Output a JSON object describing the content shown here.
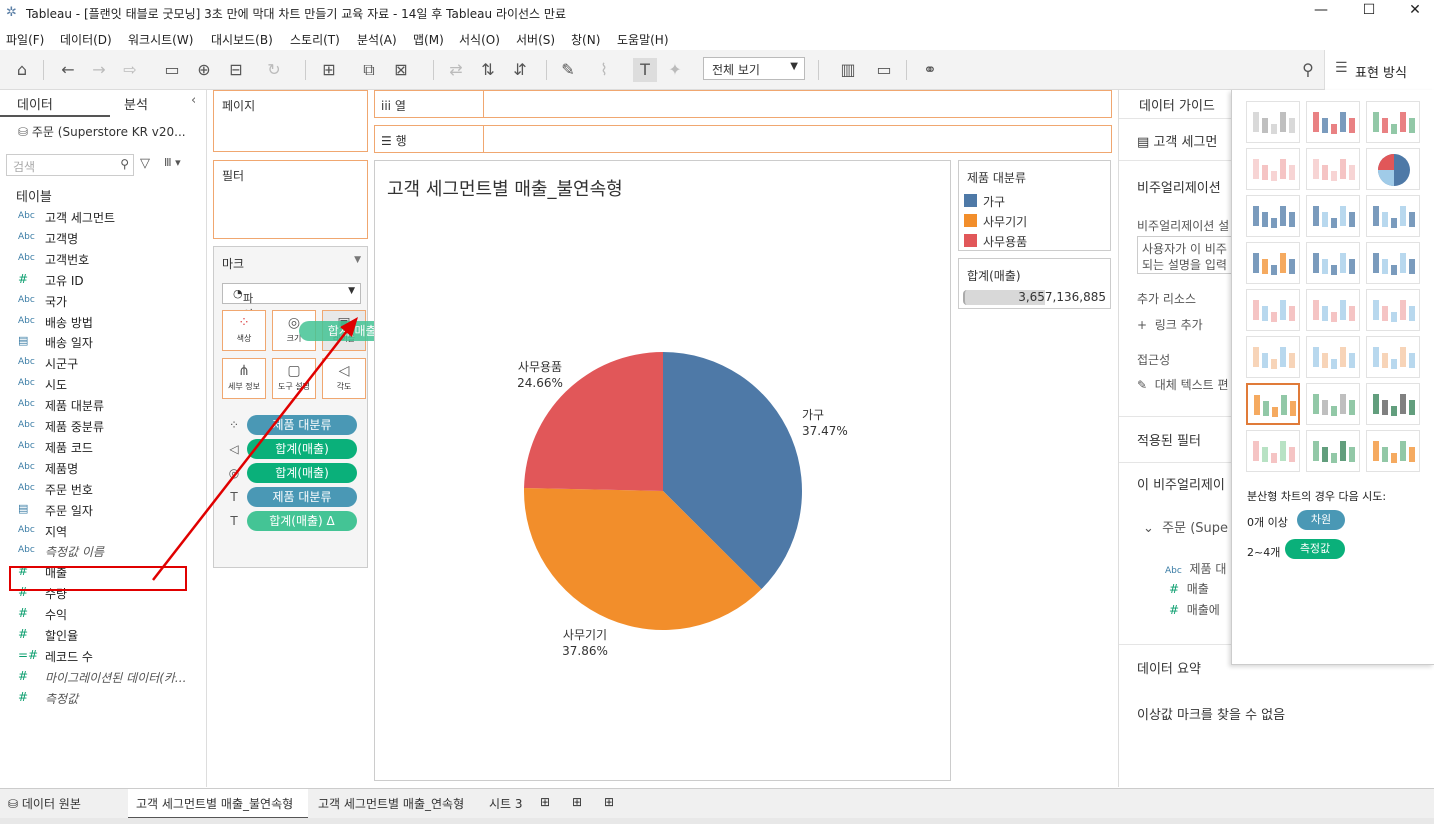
{
  "window": {
    "title": "Tableau - [플랜잇 태블로 굿모닝] 3초 만에 막대 차트 만들기 교육 자료 - 14일 후 Tableau 라이선스 만료"
  },
  "menu": [
    "파일(F)",
    "데이터(D)",
    "워크시트(W)",
    "대시보드(B)",
    "스토리(T)",
    "분석(A)",
    "맵(M)",
    "서식(O)",
    "서버(S)",
    "창(N)",
    "도움말(H)"
  ],
  "toolbar": {
    "view_mode": "전체 보기",
    "show_me_label": "표현 방식"
  },
  "datapane": {
    "tab_data": "데이터",
    "tab_analysis": "분석",
    "datasource": "주문 (Superstore KR v20...",
    "search_placeholder": "검색",
    "tables_heading": "테이블",
    "fields": [
      {
        "type": "Abc",
        "name": "고객 세그먼트"
      },
      {
        "type": "Abc",
        "name": "고객명"
      },
      {
        "type": "Abc",
        "name": "고객번호"
      },
      {
        "type": "#",
        "name": "고유 ID"
      },
      {
        "type": "Abc",
        "name": "국가"
      },
      {
        "type": "Abc",
        "name": "배송 방법"
      },
      {
        "type": "date",
        "name": "배송 일자"
      },
      {
        "type": "Abc",
        "name": "시군구"
      },
      {
        "type": "Abc",
        "name": "시도"
      },
      {
        "type": "Abc",
        "name": "제품 대분류"
      },
      {
        "type": "Abc",
        "name": "제품 중분류"
      },
      {
        "type": "Abc",
        "name": "제품 코드"
      },
      {
        "type": "Abc",
        "name": "제품명"
      },
      {
        "type": "Abc",
        "name": "주문 번호"
      },
      {
        "type": "date",
        "name": "주문 일자"
      },
      {
        "type": "Abc",
        "name": "지역"
      },
      {
        "type": "Abc",
        "name": "측정값 이름"
      },
      {
        "type": "#",
        "name": "매출"
      },
      {
        "type": "#",
        "name": "수량"
      },
      {
        "type": "#",
        "name": "수익"
      },
      {
        "type": "#",
        "name": "할인율"
      },
      {
        "type": "=#",
        "name": "레코드 수"
      },
      {
        "type": "#",
        "name": "마이그레이션된 데이터(카..."
      },
      {
        "type": "#",
        "name": "측정값"
      }
    ]
  },
  "shelves": {
    "pages": "페이지",
    "filters": "필터",
    "columns": "열",
    "rows": "행"
  },
  "marks": {
    "heading": "마크",
    "type": "파이 차트",
    "buttons": [
      "색상",
      "크기",
      "레이블",
      "세부 정보",
      "도구 설명",
      "각도"
    ],
    "drag_pill": "합계(매출)",
    "pills": [
      {
        "icon": "color",
        "label": "제품 대분류",
        "kind": "dim"
      },
      {
        "icon": "angle",
        "label": "합계(매출)",
        "kind": "meas"
      },
      {
        "icon": "size",
        "label": "합계(매출)",
        "kind": "meas"
      },
      {
        "icon": "label",
        "label": "제품 대분류",
        "kind": "dim"
      },
      {
        "icon": "label",
        "label": "합계(매출)",
        "kind": "drop",
        "suffix": "Δ"
      }
    ]
  },
  "view": {
    "title": "고객 세그먼트별 매출_불연속형"
  },
  "legend": {
    "title": "제품 대분류",
    "items": [
      {
        "label": "가구",
        "color": "#4e79a7"
      },
      {
        "label": "사무기기",
        "color": "#f28e2b"
      },
      {
        "label": "사무용품",
        "color": "#e15759"
      }
    ]
  },
  "size_legend": {
    "title": "합계(매출)",
    "value": "3,657,136,885"
  },
  "chart_data": {
    "type": "pie",
    "categories": [
      "가구",
      "사무기기",
      "사무용품"
    ],
    "values": [
      37.47,
      37.86,
      24.66
    ],
    "labels": [
      "가구\n37.47%",
      "사무기기\n37.86%",
      "사무용품\n24.66%"
    ],
    "colors": [
      "#4e79a7",
      "#f28e2b",
      "#e15759"
    ]
  },
  "guide": {
    "title": "데이터 가이드",
    "item": "고객 세그먼",
    "viz_h": "비주얼리제이션",
    "viz_desc_label": "비주얼리제이션 설",
    "viz_desc_box1": "사용자가 이 비주",
    "viz_desc_box2": "되는 설명을 입력",
    "resources": "추가 리소스",
    "add_link": "링크 추가",
    "access": "접근성",
    "alt_text": "대체 텍스트 편",
    "applied_filters": "적용된 필터",
    "this_viz": "이 비주얼리제이",
    "source": "주문 (Supe",
    "src_fields": [
      "제품 대",
      "매출",
      "매출에"
    ],
    "data_summary": "데이터 요약",
    "outliers": "이상값 마크를 찾을 수 없음"
  },
  "showme": {
    "hint": "분산형 차트의 경우 다음 시도:",
    "row1_prefix": "0개 이상",
    "row1_pill": "차원",
    "row2_prefix": "2~4개",
    "row2_pill": "측정값"
  },
  "bottom": {
    "datasource_tab": "데이터 원본",
    "sheets": [
      "고객 세그먼트별 매출_불연속형",
      "고객 세그먼트별 매출_연속형",
      "시트 3"
    ]
  }
}
